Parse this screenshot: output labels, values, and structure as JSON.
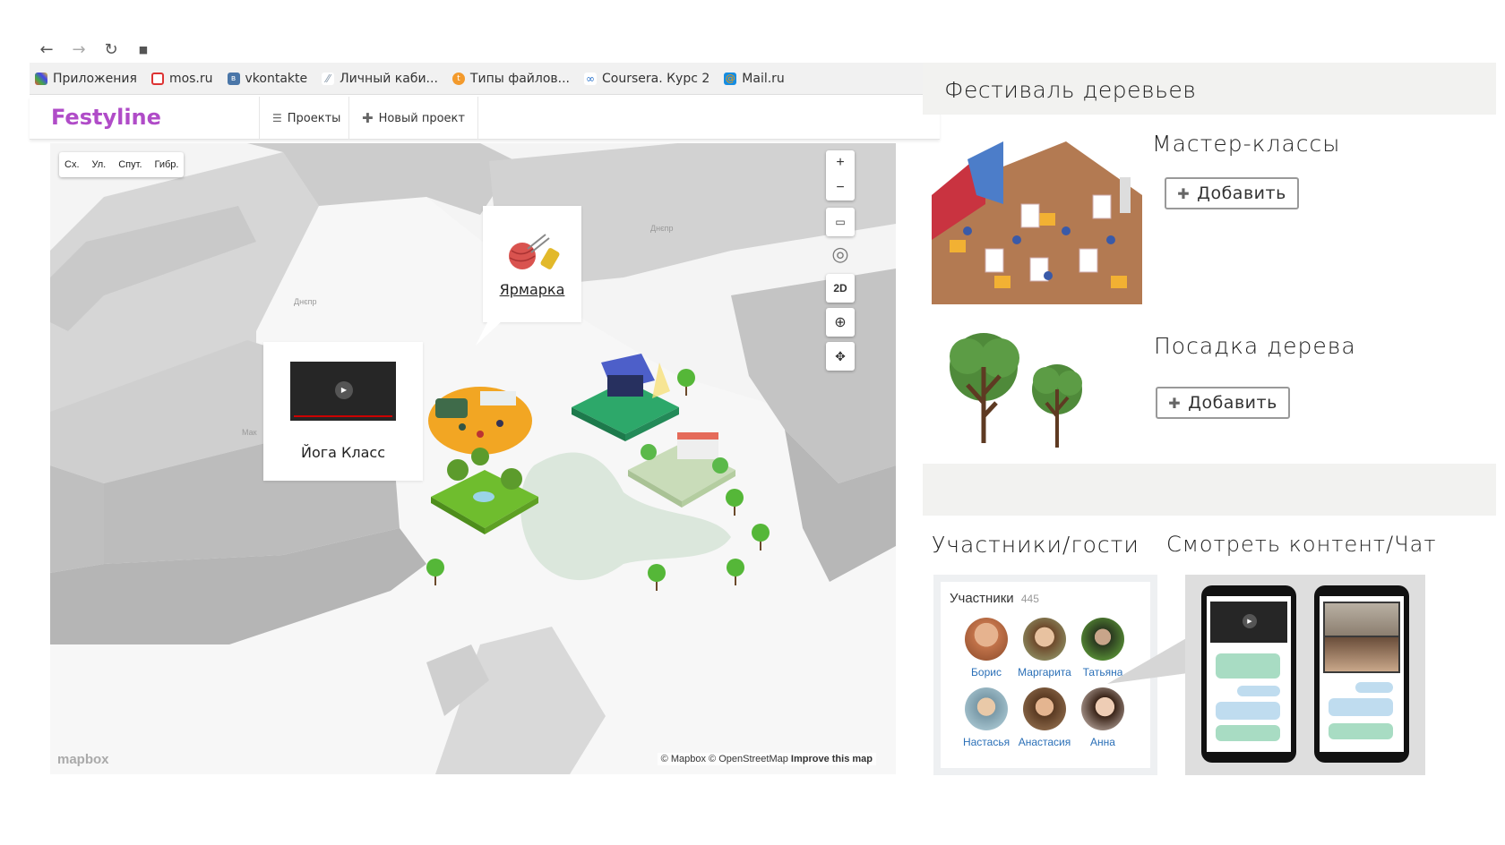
{
  "browser": {
    "nav": {
      "back_icon": "arrow-left-icon",
      "forward_icon": "arrow-right-icon",
      "reload_icon": "reload-icon",
      "lock_icon": "lock-icon"
    },
    "bookmarks": [
      {
        "label": "Приложения",
        "icon": "apps-grid-icon"
      },
      {
        "label": "mos.ru",
        "icon": "mos-icon"
      },
      {
        "label": "vkontakte",
        "icon": "vk-icon"
      },
      {
        "label": "Личный каби...",
        "icon": "feather-icon"
      },
      {
        "label": "Типы файлов...",
        "icon": "orange-circle-icon"
      },
      {
        "label": "Coursera. Курс 2",
        "icon": "coursera-icon"
      },
      {
        "label": "Mail.ru",
        "icon": "mailru-icon"
      }
    ]
  },
  "app": {
    "logo": "Festyline",
    "tabs": [
      {
        "label": "Проекты",
        "icon": "list-icon"
      },
      {
        "label": "Новый проект",
        "icon": "plus-icon"
      }
    ]
  },
  "map": {
    "types": [
      "Сх.",
      "Ул.",
      "Спут.",
      "Гибр."
    ],
    "controls": {
      "zoom_in": "+",
      "zoom_out": "−",
      "mode_2d": "2D"
    },
    "popups": {
      "fair": "Ярмарка",
      "yoga": "Йога Класс"
    },
    "street_labels": [
      "Днєпр",
      "Днєпр",
      "Мак"
    ],
    "attribution": {
      "mapbox": "© Mapbox",
      "osm": "© OpenStreetMap",
      "improve": "Improve this map"
    },
    "logo": "mapbox"
  },
  "right": {
    "festival_title": "Фестиваль деревьев",
    "workshops": {
      "title": "Мастер-классы",
      "add": "Добавить"
    },
    "planting": {
      "title": "Посадка дерева",
      "add": "Добавить"
    },
    "participants_title": "Участники/гости",
    "content_title": "Смотреть контент/Чат",
    "participants_card": {
      "label": "Участники",
      "count": "445",
      "people": [
        "Борис",
        "Маргарита",
        "Татьяна",
        "Настасья",
        "Анастасия",
        "Анна"
      ]
    }
  },
  "colors": {
    "brand": "#b04cc8",
    "link": "#2a6fb7",
    "grass": "#3fae6a",
    "tree": "#4a7c3a"
  }
}
